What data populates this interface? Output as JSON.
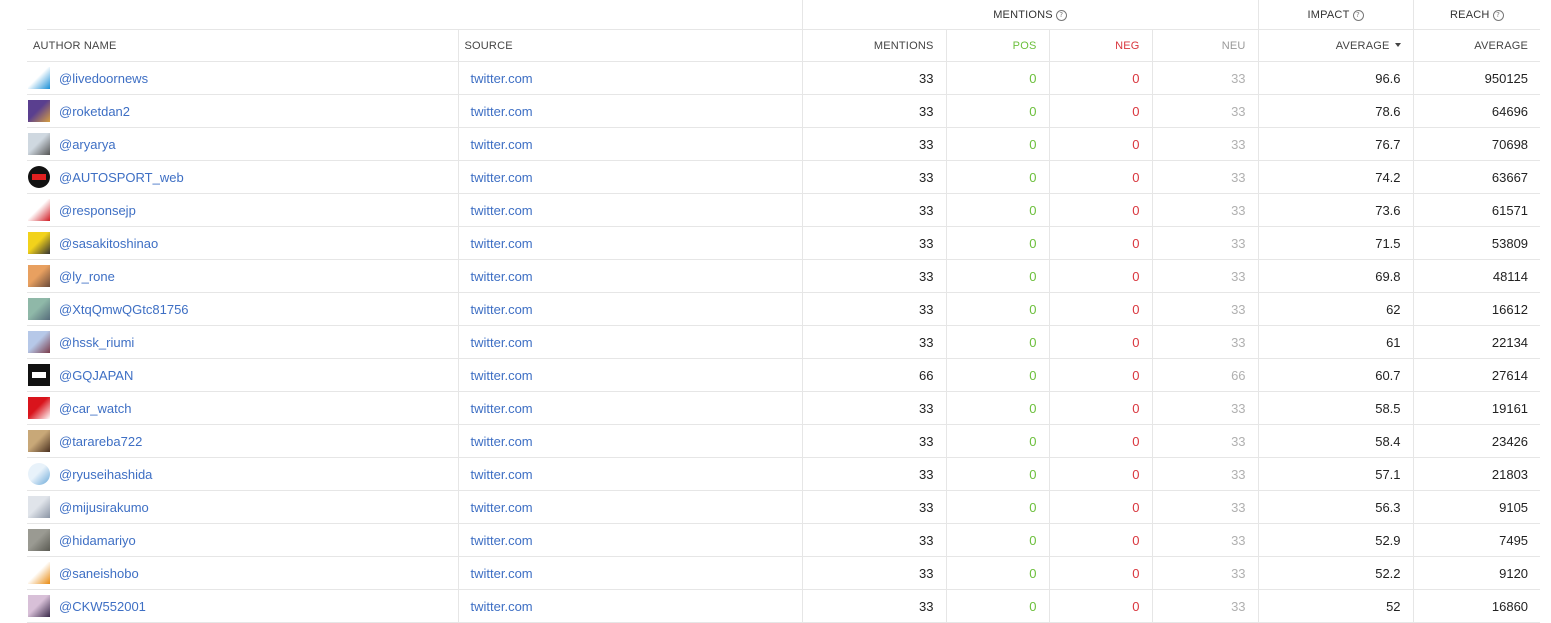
{
  "header": {
    "groups": {
      "mentions": "MENTIONS",
      "impact": "IMPACT",
      "reach": "REACH"
    },
    "columns": {
      "author_name": "AUTHOR NAME",
      "source": "SOURCE",
      "mentions": "MENTIONS",
      "pos": "POS",
      "neg": "NEG",
      "neu": "NEU",
      "impact_average": "AVERAGE",
      "reach_average": "AVERAGE"
    }
  },
  "colors": {
    "link": "#3e6fc4",
    "positive": "#6bbf3b",
    "negative": "#d9363e",
    "neutral": "#b0b0b0"
  },
  "rows": [
    {
      "handle": "@livedoornews",
      "source": "twitter.com",
      "mentions": "33",
      "pos": "0",
      "neg": "0",
      "neu": "33",
      "impact": "96.6",
      "reach": "950125",
      "avatar": {
        "icon": "livedoor-news-logo",
        "colors": [
          "#ffffff",
          "#1a8fd6"
        ],
        "round": false
      }
    },
    {
      "handle": "@roketdan2",
      "source": "twitter.com",
      "mentions": "33",
      "pos": "0",
      "neg": "0",
      "neu": "33",
      "impact": "78.6",
      "reach": "64696",
      "avatar": {
        "icon": "illustration-avatar",
        "colors": [
          "#5a3f8f",
          "#d8a040"
        ],
        "round": false
      }
    },
    {
      "handle": "@aryarya",
      "source": "twitter.com",
      "mentions": "33",
      "pos": "0",
      "neg": "0",
      "neu": "33",
      "impact": "76.7",
      "reach": "70698",
      "avatar": {
        "icon": "building-photo-avatar",
        "colors": [
          "#cfd8e0",
          "#555555"
        ],
        "round": false
      }
    },
    {
      "handle": "@AUTOSPORT_web",
      "source": "twitter.com",
      "mentions": "33",
      "pos": "0",
      "neg": "0",
      "neu": "33",
      "impact": "74.2",
      "reach": "63667",
      "avatar": {
        "icon": "autosport-logo",
        "colors": [
          "#111111",
          "#e02020"
        ],
        "round": true
      }
    },
    {
      "handle": "@responsejp",
      "source": "twitter.com",
      "mentions": "33",
      "pos": "0",
      "neg": "0",
      "neu": "33",
      "impact": "73.6",
      "reach": "61571",
      "avatar": {
        "icon": "response-logo",
        "colors": [
          "#ffffff",
          "#d01c24"
        ],
        "round": false
      }
    },
    {
      "handle": "@sasakitoshinao",
      "source": "twitter.com",
      "mentions": "33",
      "pos": "0",
      "neg": "0",
      "neu": "33",
      "impact": "71.5",
      "reach": "53809",
      "avatar": {
        "icon": "portrait-avatar",
        "colors": [
          "#f2d21b",
          "#333333"
        ],
        "round": false
      }
    },
    {
      "handle": "@ly_rone",
      "source": "twitter.com",
      "mentions": "33",
      "pos": "0",
      "neg": "0",
      "neu": "33",
      "impact": "69.8",
      "reach": "48114",
      "avatar": {
        "icon": "anime-avatar",
        "colors": [
          "#e8a060",
          "#6a4a3a"
        ],
        "round": false
      }
    },
    {
      "handle": "@XtqQmwQGtc81756",
      "source": "twitter.com",
      "mentions": "33",
      "pos": "0",
      "neg": "0",
      "neu": "33",
      "impact": "62",
      "reach": "16612",
      "avatar": {
        "icon": "anime-avatar",
        "colors": [
          "#8fb8a8",
          "#556b7a"
        ],
        "round": false
      }
    },
    {
      "handle": "@hssk_riumi",
      "source": "twitter.com",
      "mentions": "33",
      "pos": "0",
      "neg": "0",
      "neu": "33",
      "impact": "61",
      "reach": "22134",
      "avatar": {
        "icon": "anime-avatar",
        "colors": [
          "#b6c8e8",
          "#7a3b4a"
        ],
        "round": false
      }
    },
    {
      "handle": "@GQJAPAN",
      "source": "twitter.com",
      "mentions": "66",
      "pos": "0",
      "neg": "0",
      "neu": "66",
      "impact": "60.7",
      "reach": "27614",
      "avatar": {
        "icon": "gq-logo",
        "colors": [
          "#111111",
          "#ffffff"
        ],
        "round": false
      }
    },
    {
      "handle": "@car_watch",
      "source": "twitter.com",
      "mentions": "33",
      "pos": "0",
      "neg": "0",
      "neu": "33",
      "impact": "58.5",
      "reach": "19161",
      "avatar": {
        "icon": "car-watch-logo",
        "colors": [
          "#d9141c",
          "#ffffff"
        ],
        "round": false
      }
    },
    {
      "handle": "@tarareba722",
      "source": "twitter.com",
      "mentions": "33",
      "pos": "0",
      "neg": "0",
      "neu": "33",
      "impact": "58.4",
      "reach": "23426",
      "avatar": {
        "icon": "dog-photo-avatar",
        "colors": [
          "#c8a878",
          "#4a3020"
        ],
        "round": false
      }
    },
    {
      "handle": "@ryuseihashida",
      "source": "twitter.com",
      "mentions": "33",
      "pos": "0",
      "neg": "0",
      "neu": "33",
      "impact": "57.1",
      "reach": "21803",
      "avatar": {
        "icon": "illustration-avatar",
        "colors": [
          "#e8f2fa",
          "#6aa8d8"
        ],
        "round": true
      }
    },
    {
      "handle": "@mijusirakumo",
      "source": "twitter.com",
      "mentions": "33",
      "pos": "0",
      "neg": "0",
      "neu": "33",
      "impact": "56.3",
      "reach": "9105",
      "avatar": {
        "icon": "cat-photo-avatar",
        "colors": [
          "#e0e4ea",
          "#8a94a4"
        ],
        "round": false
      }
    },
    {
      "handle": "@hidamariyo",
      "source": "twitter.com",
      "mentions": "33",
      "pos": "0",
      "neg": "0",
      "neu": "33",
      "impact": "52.9",
      "reach": "7495",
      "avatar": {
        "icon": "cat-photo-avatar",
        "colors": [
          "#9a9a92",
          "#5a5a52"
        ],
        "round": false
      }
    },
    {
      "handle": "@saneishobo",
      "source": "twitter.com",
      "mentions": "33",
      "pos": "0",
      "neg": "0",
      "neu": "33",
      "impact": "52.2",
      "reach": "9120",
      "avatar": {
        "icon": "saneishobo-logo",
        "colors": [
          "#ffffff",
          "#e88a10"
        ],
        "round": false
      }
    },
    {
      "handle": "@CKW552001",
      "source": "twitter.com",
      "mentions": "33",
      "pos": "0",
      "neg": "0",
      "neu": "33",
      "impact": "52",
      "reach": "16860",
      "avatar": {
        "icon": "anime-avatar",
        "colors": [
          "#d8c0d8",
          "#3a2a4a"
        ],
        "round": false
      }
    }
  ]
}
